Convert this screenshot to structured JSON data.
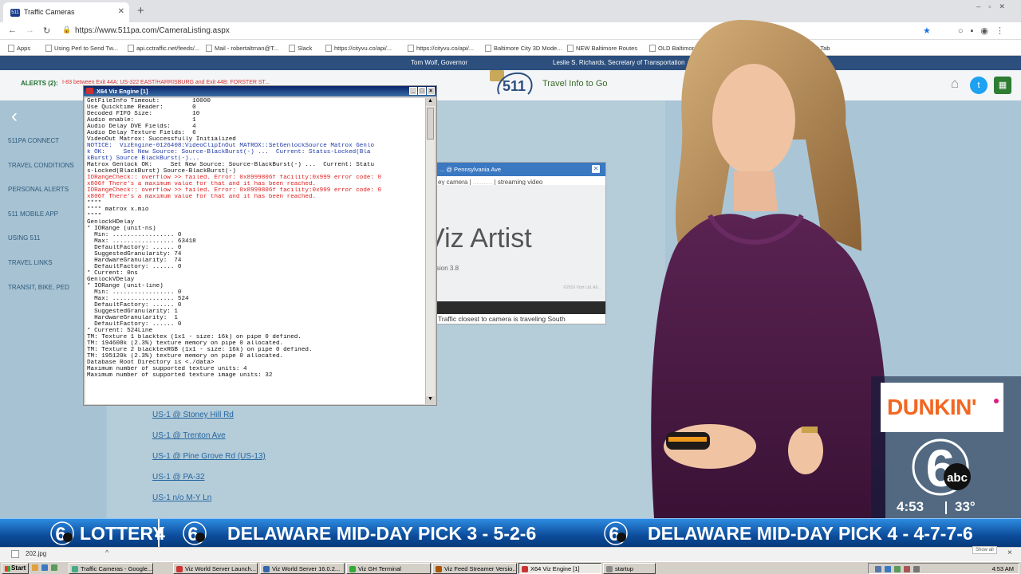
{
  "browser": {
    "tab_title": "Traffic Cameras",
    "tab_favicon": "511",
    "new_tab_label": "+",
    "url": "https://www.511pa.com/CameraListing.aspx",
    "bookmarks": [
      {
        "label": "Apps"
      },
      {
        "label": "Using Perl to Send Tw..."
      },
      {
        "label": "api.cctraffic.net/feeds/..."
      },
      {
        "label": "Mail - robertaltman@T..."
      },
      {
        "label": "Slack"
      },
      {
        "label": "https://cityvu.co/api/..."
      },
      {
        "label": "https://cityvu.co/api/..."
      },
      {
        "label": "Baltimore City 3D Mode..."
      },
      {
        "label": "NEW Baltimore Routes"
      },
      {
        "label": "OLD Baltimore R..."
      },
      {
        "label": "w Tab"
      }
    ]
  },
  "site": {
    "governor": "Tom Wolf, Governor",
    "secretary": "Leslie S. Richards, Secretary of Transportation",
    "alerts_label": "ALERTS (2):",
    "alert_text": "I-83 between Exit 44A: US-322 EAST/HARRISBURG and Exit 44B: FORSTER ST...",
    "logo_text": "511",
    "tagline": "Travel Info to Go",
    "nav": [
      "511PA CONNECT",
      "TRAVEL CONDITIONS",
      "PERSONAL ALERTS",
      "511 MOBILE APP",
      "USING 511",
      "TRAVEL LINKS",
      "TRANSIT, BIKE, PED"
    ],
    "camera_links": [
      "US-1 @ Stoney Hill Rd",
      "US-1 @ Trenton Ave",
      "US-1 @ Pine Grove Rd (US-13)",
      "US-1 @ PA-32",
      "US-1 n/o M-Y Ln"
    ]
  },
  "popup": {
    "title": "... @ Pennsylvania Ave",
    "tab_still": "ey camera |",
    "tab_sep": "|",
    "tab_streaming": "streaming video",
    "splash_title": "Viz Artist",
    "splash_version": "sion 3.8",
    "splash_copyright": "©2016 Vizrt Ltd. All...",
    "caption": "Traffic closest to camera is traveling South"
  },
  "console": {
    "title": "X64 Viz Engine [1]",
    "lines": [
      {
        "t": "GetFileInfo Timeout:         10000",
        "c": ""
      },
      {
        "t": "Use Quicktime Reader:        0",
        "c": ""
      },
      {
        "t": "Decoded FIFO Size:           10",
        "c": ""
      },
      {
        "t": "Audio enable:                1",
        "c": ""
      },
      {
        "t": "Audio Delay DVE Fields:      4",
        "c": ""
      },
      {
        "t": "Audio Delay Texture Fields:  6",
        "c": ""
      },
      {
        "t": "VideoOut Matrox: Successfully Initialized",
        "c": ""
      },
      {
        "t": "NOTICE:  VizEngine-0126408:VideoClipInOut MATROX::SetGenlockSource Matrox Genlo",
        "c": "blue"
      },
      {
        "t": "k OK:     Set New Source: Source-BlackBurst(-) ...  Current: Status-Locked(Bla",
        "c": "blue"
      },
      {
        "t": "kBurst) Source BlackBurst(-)...",
        "c": "blue"
      },
      {
        "t": "Matrox Genlock OK:     Set New Source: Source-BlackBurst(-) ...  Current: Statu",
        "c": ""
      },
      {
        "t": "s-Locked(BlackBurst) Source-BlackBurst(-)",
        "c": ""
      },
      {
        "t": "IORangeCheck:: overflow >> failed. Error: 0x8999806f facility:0x999 error code: 0",
        "c": "red"
      },
      {
        "t": "x806f There's a maximum value for that and it has been reached.",
        "c": "red"
      },
      {
        "t": "IORangeCheck:: overflow >> failed. Error: 0x8999806f facility:0x999 error code: 0",
        "c": "red"
      },
      {
        "t": "x806f There's a maximum value for that and it has been reached.",
        "c": "red"
      },
      {
        "t": "****",
        "c": ""
      },
      {
        "t": "**** matrox x.mio",
        "c": ""
      },
      {
        "t": "****",
        "c": ""
      },
      {
        "t": "GenlockHDelay",
        "c": ""
      },
      {
        "t": "* IORange (unit-ns)",
        "c": ""
      },
      {
        "t": "  Min: ................. 0",
        "c": ""
      },
      {
        "t": "  Max: ................. 63418",
        "c": ""
      },
      {
        "t": "  DefaultFactory: ...... 0",
        "c": ""
      },
      {
        "t": "  SuggestedGranularity: 74",
        "c": ""
      },
      {
        "t": "  HardwareGranularity:  74",
        "c": ""
      },
      {
        "t": "  DefaultFactory: ...... 0",
        "c": ""
      },
      {
        "t": "* Current: 0ns",
        "c": ""
      },
      {
        "t": "",
        "c": ""
      },
      {
        "t": "GenlockVDelay",
        "c": ""
      },
      {
        "t": "* IORange (unit-line)",
        "c": ""
      },
      {
        "t": "  Min: ................. 0",
        "c": ""
      },
      {
        "t": "  Max: ................. 524",
        "c": ""
      },
      {
        "t": "  DefaultFactory: ...... 0",
        "c": ""
      },
      {
        "t": "  SuggestedGranularity: 1",
        "c": ""
      },
      {
        "t": "  HardwareGranularity:  1",
        "c": ""
      },
      {
        "t": "  DefaultFactory: ...... 0",
        "c": ""
      },
      {
        "t": "* Current: 524Line",
        "c": ""
      },
      {
        "t": "",
        "c": ""
      },
      {
        "t": "TM: Texture 1 blacktex (1x1 - size: 16k) on pipe 0 defined.",
        "c": ""
      },
      {
        "t": "TM: 194608k (2.3%) texture memory on pipe 0 allocated.",
        "c": ""
      },
      {
        "t": "TM: Texture 2 blacktexRGB (1x1 - size: 16k) on pipe 0 defined.",
        "c": ""
      },
      {
        "t": "TM: 195120k (2.3%) texture memory on pipe 0 allocated.",
        "c": ""
      },
      {
        "t": "Database Root Directory is <./data>",
        "c": ""
      },
      {
        "t": "Maximum number of supported texture units: 4",
        "c": ""
      },
      {
        "t": "Maximum number of supported texture image units: 32",
        "c": ""
      }
    ]
  },
  "broadcast": {
    "sponsor": "DUNKIN'",
    "time": "4:53",
    "temperature": "33°",
    "ticker": [
      {
        "text": "LOTTERY"
      },
      {
        "text": "4"
      },
      {
        "text": "DELAWARE MID-DAY PICK 3 - 5-2-6"
      },
      {
        "text": "DELAWARE MID-DAY PICK 4 - 4-7-7-6"
      }
    ],
    "colors": {
      "sponsor": "#f26722",
      "ticker": "#0d4d9c"
    }
  },
  "downloads": {
    "file": "202.jpg",
    "more": "^",
    "show_all": "Show all",
    "close": "×"
  },
  "taskbar": {
    "start": "Start",
    "buttons": [
      "Traffic Cameras - Google...",
      "Viz World Server Launch...",
      "Viz World Server 16.0.2...",
      "Viz GH Terminal",
      "Viz Feed Streamer Versio...",
      "X64 Viz Engine [1]",
      "startup"
    ],
    "clock": "4:53 AM"
  }
}
